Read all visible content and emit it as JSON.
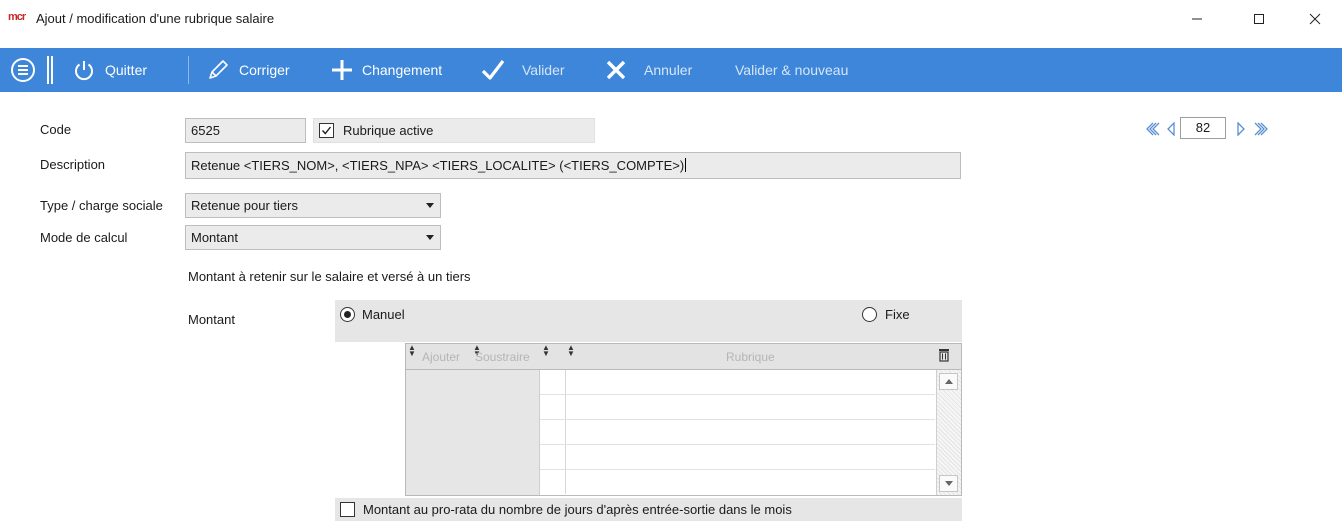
{
  "window": {
    "logo": "mcr",
    "title": "Ajout / modification d'une rubrique salaire",
    "controls": {
      "minimize_icon": "minimize-icon",
      "maximize_icon": "maximize-icon",
      "close_icon": "close-icon"
    }
  },
  "toolbar": {
    "background": "#3d86d9",
    "menu_icon": "hamburger-circle-icon",
    "quit": {
      "label": "Quitter",
      "icon": "power-icon"
    },
    "edit": {
      "label": "Corriger",
      "icon": "pencil-icon"
    },
    "change": {
      "label": "Changement",
      "icon": "plus-icon"
    },
    "validate": {
      "label": "Valider",
      "icon": "checkmark-icon",
      "enabled": false
    },
    "cancel": {
      "label": "Annuler",
      "icon": "x-icon",
      "enabled": false
    },
    "validate_new": {
      "label": "Valider & nouveau",
      "enabled": false
    }
  },
  "form": {
    "code": {
      "label": "Code",
      "value": "6525"
    },
    "active": {
      "label": "Rubrique active",
      "checked": true
    },
    "description": {
      "label": "Description",
      "value": "Retenue <TIERS_NOM>, <TIERS_NPA> <TIERS_LOCALITE> (<TIERS_COMPTE>)"
    },
    "type": {
      "label": "Type / charge sociale",
      "value": "Retenue pour tiers"
    },
    "mode": {
      "label": "Mode de calcul",
      "value": "Montant"
    },
    "mode_description": "Montant à retenir sur le salaire et versé à un tiers",
    "amount": {
      "label": "Montant",
      "options": [
        {
          "label": "Manuel",
          "selected": true
        },
        {
          "label": "Fixe",
          "selected": false
        }
      ]
    },
    "grid": {
      "columns": [
        "Ajouter",
        "Soustraire",
        "Rubrique"
      ],
      "row_count": 5,
      "delete_icon": "trash-icon"
    },
    "prorata": {
      "label": "Montant au pro-rata du nombre de jours d'après entrée-sortie dans le mois",
      "checked": false
    }
  },
  "navigator": {
    "record": "82",
    "first_icon": "first-record-icon",
    "prev_icon": "previous-record-icon",
    "next_icon": "next-record-icon",
    "last_icon": "last-record-icon"
  }
}
